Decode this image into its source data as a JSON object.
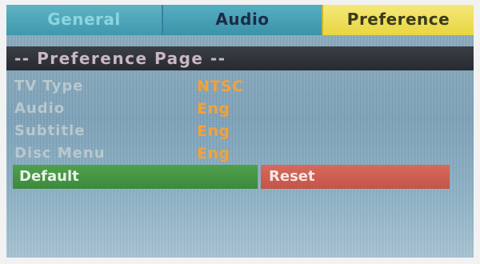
{
  "tabs": [
    {
      "label": "General"
    },
    {
      "label": "Audio"
    },
    {
      "label": "Preference",
      "selected": true
    }
  ],
  "section_title": "-- Preference Page --",
  "settings": [
    {
      "label": "TV Type",
      "value": "NTSC"
    },
    {
      "label": "Audio",
      "value": "Eng"
    },
    {
      "label": "Subtitle",
      "value": "Eng"
    },
    {
      "label": "Disc Menu",
      "value": "Eng"
    }
  ],
  "buttons": {
    "default_label": "Default",
    "reset_label": "Reset"
  },
  "colors": {
    "selected_tab": "#e8d640",
    "value_text": "#f2a23a",
    "default_button": "#3c8a3d",
    "reset_button": "#c35448"
  }
}
